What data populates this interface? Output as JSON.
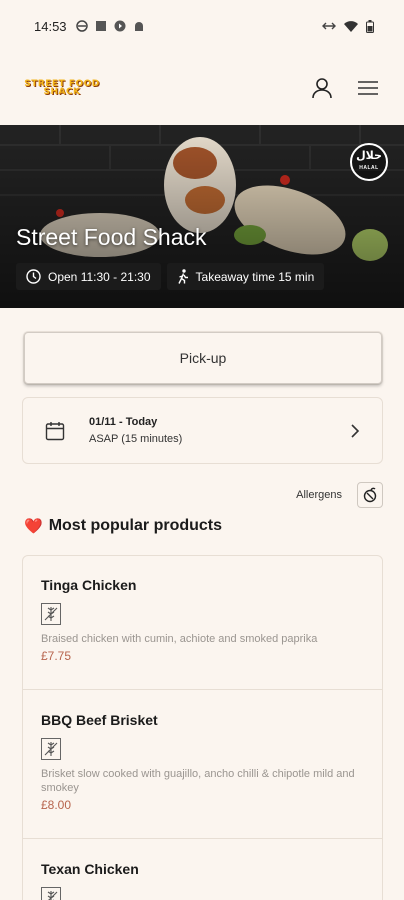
{
  "status_bar": {
    "time": "14:53"
  },
  "header": {
    "logo_line1": "STREET FOOD",
    "logo_line2": "SHACK"
  },
  "hero": {
    "title": "Street Food Shack",
    "halal_label": "حلال",
    "halal_sub": "HALAL",
    "hours": "Open 11:30 - 21:30",
    "takeaway": "Takeaway time 15 min"
  },
  "order": {
    "mode_label": "Pick-up",
    "date_line": "01/11 - Today",
    "time_line": "ASAP (15 minutes)"
  },
  "allergens_label": "Allergens",
  "section": {
    "emoji": "❤️",
    "title": "Most popular products"
  },
  "products": [
    {
      "name": "Tinga Chicken",
      "description": "Braised chicken with cumin, achiote and smoked paprika",
      "price": "£7.75"
    },
    {
      "name": "BBQ Beef Brisket",
      "description": "Brisket slow cooked with guajillo, ancho chilli & chipotle mild and smokey",
      "price": "£8.00"
    },
    {
      "name": "Texan Chicken",
      "description": "",
      "price": ""
    }
  ],
  "colors": {
    "background": "#fbf5ef",
    "price": "#b7644d",
    "logo": "#f3b51c"
  }
}
